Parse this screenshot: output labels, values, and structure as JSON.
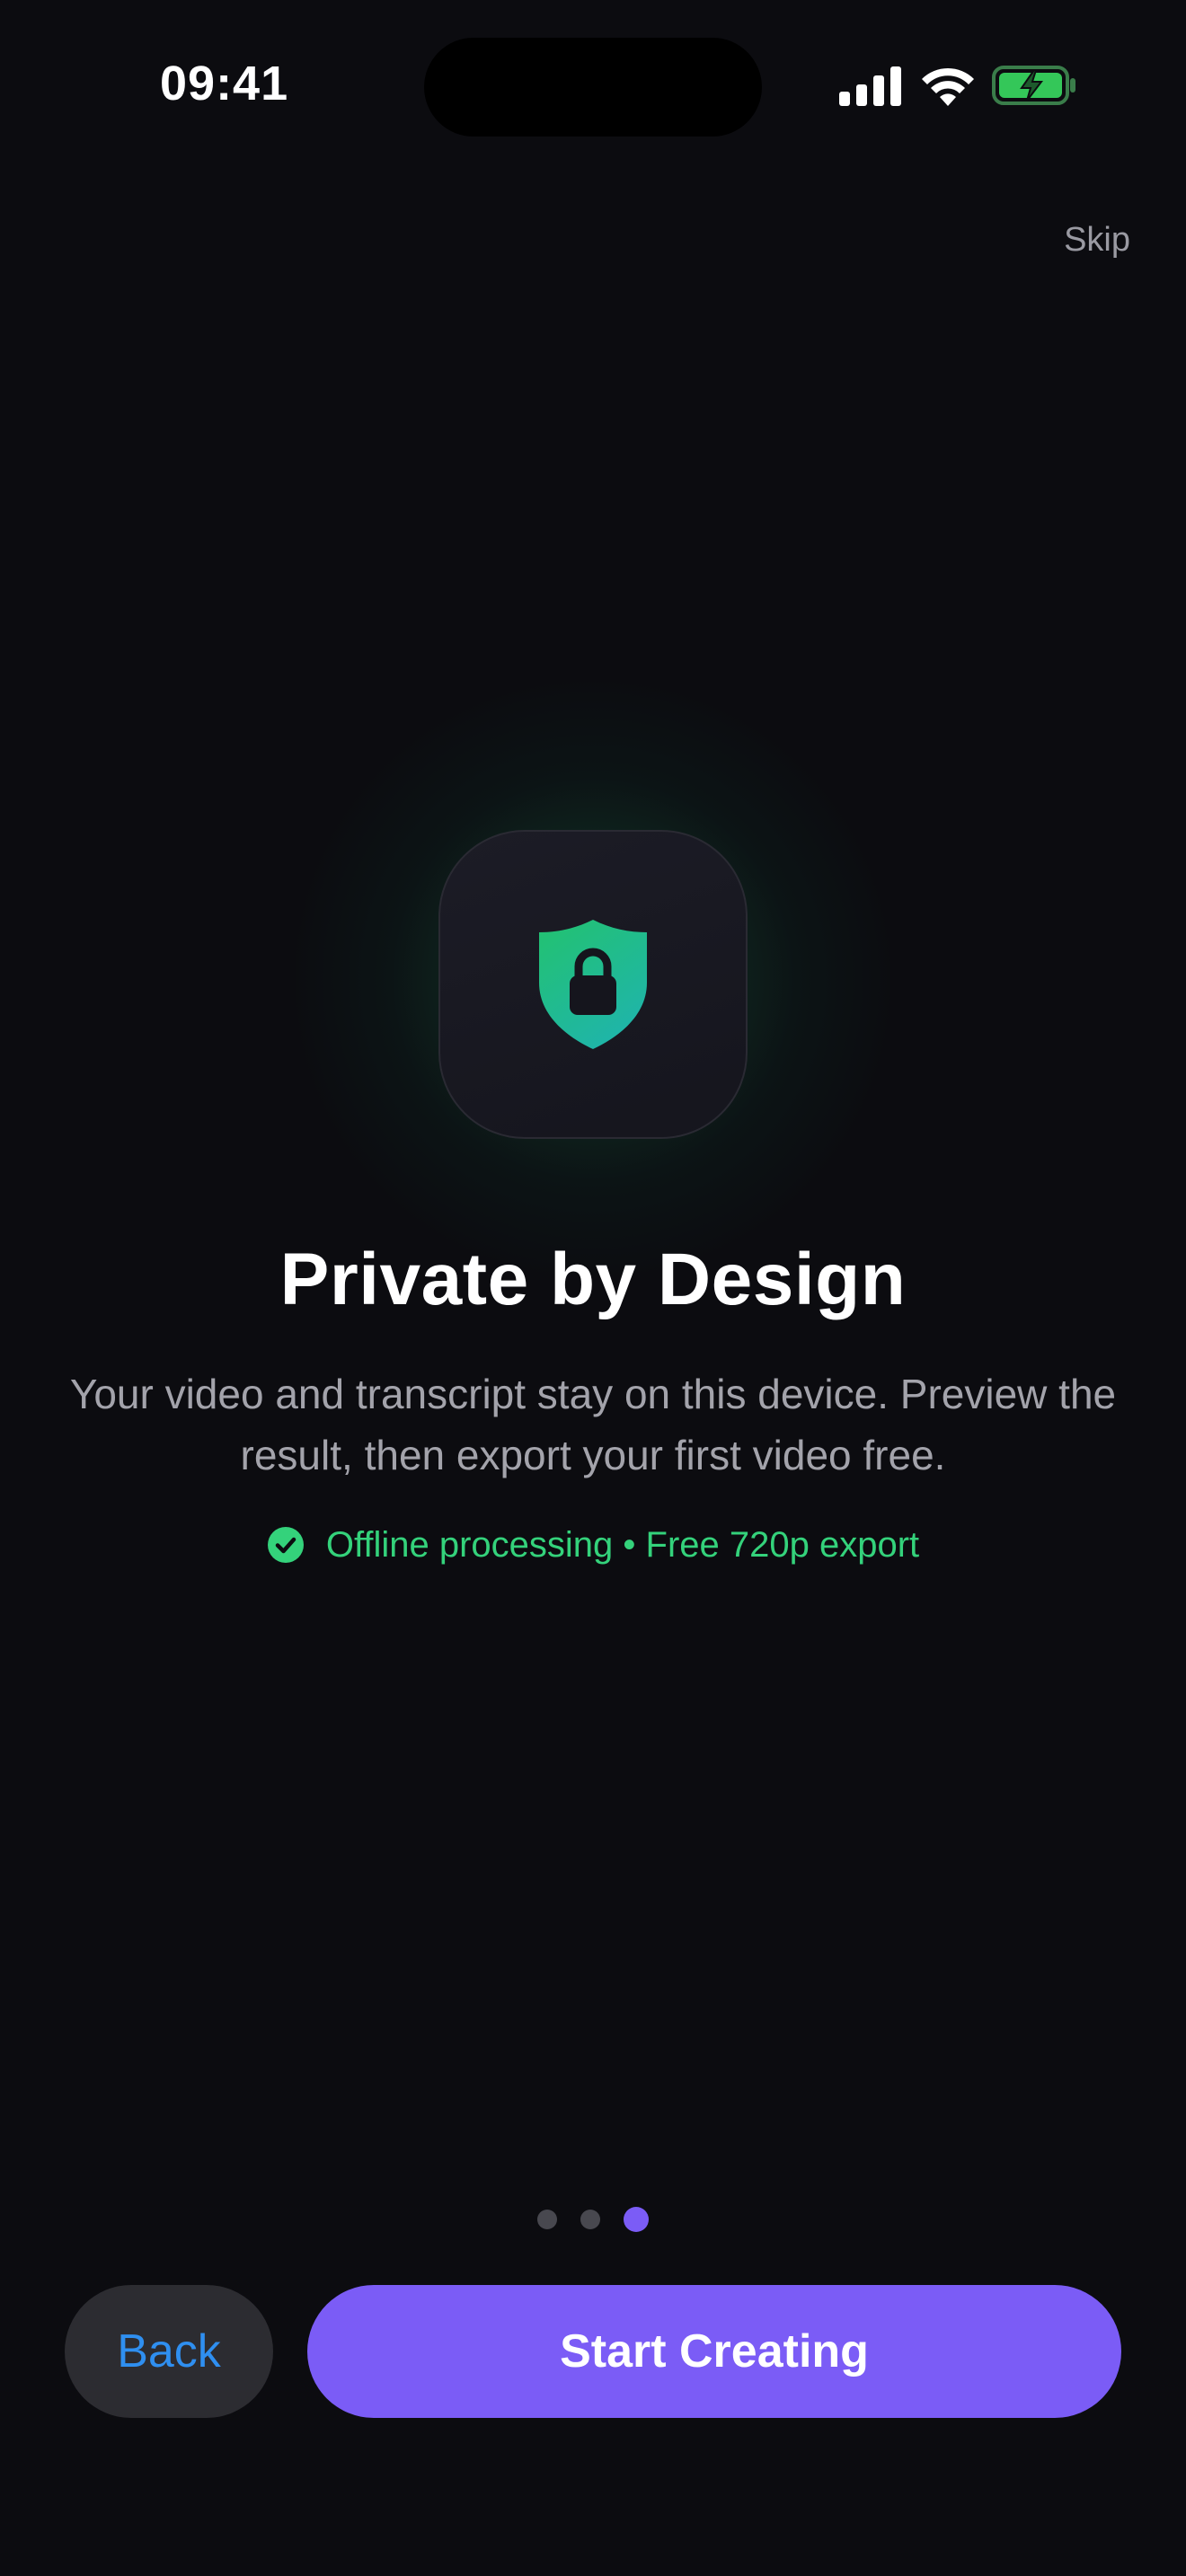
{
  "status_bar": {
    "time": "09:41",
    "icons": [
      "cellular-signal-icon",
      "wifi-icon",
      "battery-charging-icon"
    ],
    "battery_color": "#34c759"
  },
  "onboarding": {
    "skip_label": "Skip",
    "hero_icon": "shield-lock-icon",
    "title": "Private by Design",
    "description": "Your video and transcript stay on this device. Preview the result, then export your first video free.",
    "feature_icon": "checkmark-circle-icon",
    "feature_text": "Offline processing • Free 720p export",
    "page_count": 3,
    "current_page": 3
  },
  "buttons": {
    "back_label": "Back",
    "primary_label": "Start Creating"
  },
  "colors": {
    "background": "#0c0c10",
    "accent": "#7b5cf6",
    "success": "#34d27b",
    "link": "#2f8ff0"
  }
}
